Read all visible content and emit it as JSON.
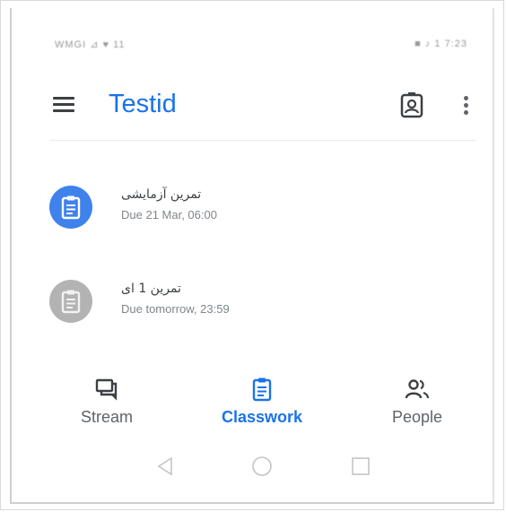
{
  "status_bar": {
    "left_text": "WMGI ⊿ ♥ 11",
    "right_text": "■ ♪ 1 7:23"
  },
  "app_bar": {
    "title": "Testid",
    "menu_icon": "hamburger-menu-icon",
    "profile_icon": "class-profile-icon",
    "more_icon": "more-vert-icon"
  },
  "assignments": [
    {
      "title": "تمرین آزمایشی",
      "due": "Due 21 Mar, 06:00",
      "icon": "assignment-icon",
      "icon_bg": "#3f82ec"
    },
    {
      "title": "تمرین 1 ای",
      "due": "Due tomorrow, 23:59",
      "icon": "assignment-icon",
      "icon_bg": "#b3b3b3"
    }
  ],
  "bottom_nav": {
    "items": [
      {
        "label": "Stream",
        "icon": "stream-icon",
        "active": false
      },
      {
        "label": "Classwork",
        "icon": "classwork-icon",
        "active": true
      },
      {
        "label": "People",
        "icon": "people-icon",
        "active": false
      }
    ]
  },
  "colors": {
    "accent": "#1a73e8",
    "text_primary": "#3c4043",
    "text_secondary": "#80868b",
    "inactive_icon": "#5f6368"
  },
  "system_nav": {
    "back_icon": "back-triangle-icon",
    "home_icon": "home-circle-icon",
    "recents_icon": "recents-square-icon"
  }
}
